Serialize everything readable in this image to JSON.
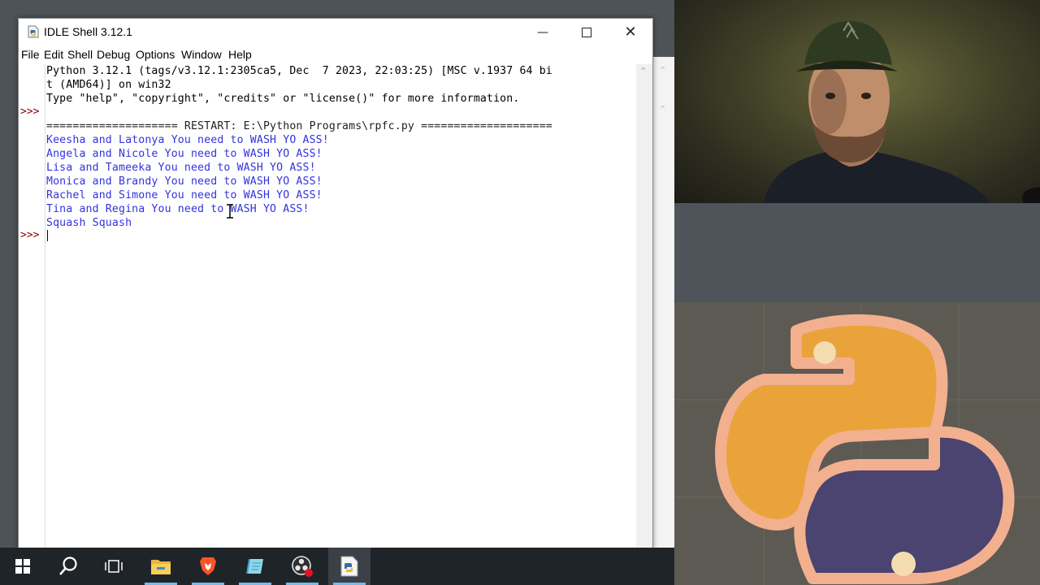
{
  "window": {
    "title": "IDLE Shell 3.12.1",
    "min_glyph": "—",
    "close_glyph": "✕"
  },
  "menubar": {
    "items": [
      "File",
      "Edit",
      "Shell",
      "Debug",
      "Options",
      "Window",
      "Help"
    ]
  },
  "shell": {
    "prompt": ">>>",
    "banner_line1": "Python 3.12.1 (tags/v3.12.1:2305ca5, Dec  7 2023, 22:03:25) [MSC v.1937 64 bi",
    "banner_line2": "t (AMD64)] on win32",
    "banner_line3": "Type \"help\", \"copyright\", \"credits\" or \"license()\" for more information.",
    "restart_line": "==================== RESTART: E:\\Python Programs\\rpfc.py ====================",
    "output": [
      "Keesha and Latonya You need to WASH YO ASS!",
      "Angela and Nicole You need to WASH YO ASS!",
      "Lisa and Tameeka You need to WASH YO ASS!",
      "Monica and Brandy You need to WASH YO ASS!",
      "Rachel and Simone You need to WASH YO ASS!",
      "Tina and Regina You need to WASH YO ASS!",
      "Squash Squash"
    ]
  },
  "taskbar": {
    "icons": [
      "windows-start-icon",
      "search-icon",
      "task-view-icon",
      "file-explorer-icon",
      "brave-browser-icon",
      "notepad-icon",
      "obs-studio-icon",
      "python-idle-icon"
    ],
    "accent_color": "#76b9ed"
  },
  "colors": {
    "output_blue": "#3333dd",
    "prompt_red": "#8b0000"
  }
}
